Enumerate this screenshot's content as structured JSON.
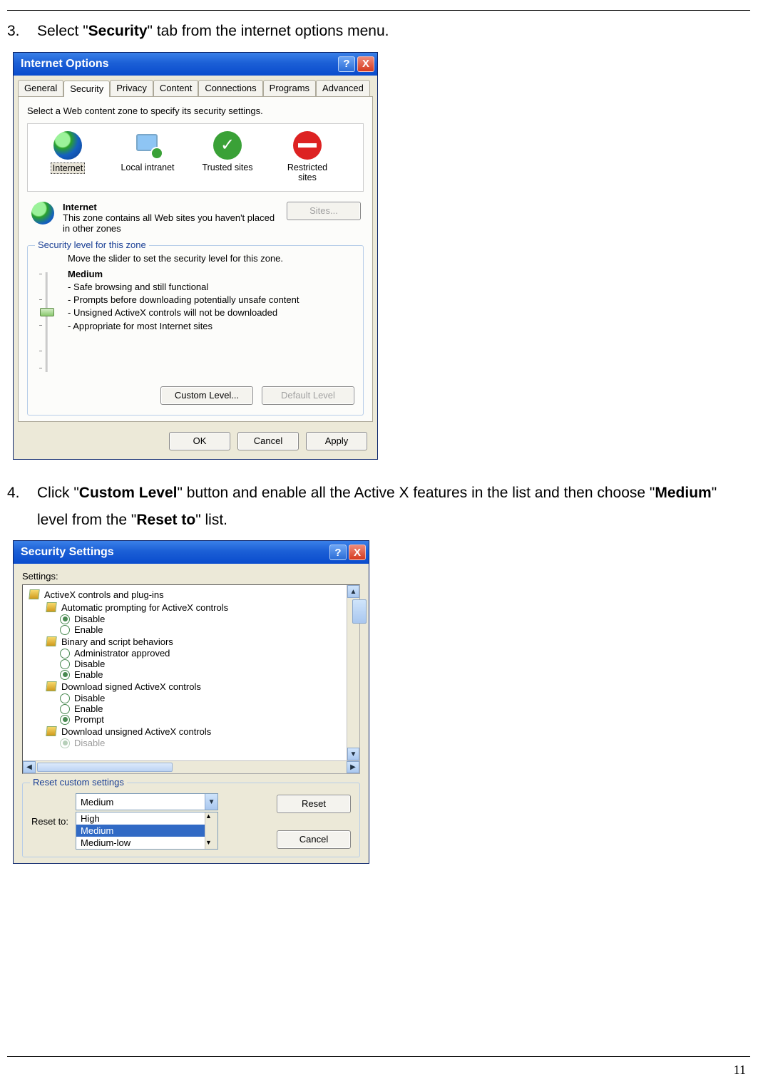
{
  "page_number": "11",
  "step3": {
    "num": "3.",
    "pre": "Select \"",
    "bold": "Security",
    "post": "\" tab from the internet options menu."
  },
  "step4": {
    "num": "4.",
    "pre1": "Click \"",
    "bold1": "Custom Level",
    "mid1": "\" button and enable all the Active X features in the list and then choose \"",
    "bold2": "Medium",
    "mid2": "\" level from the \"",
    "bold3": "Reset to",
    "post": "\" list."
  },
  "dialog1": {
    "title": "Internet Options",
    "help": "?",
    "close": "X",
    "tabs": [
      "General",
      "Security",
      "Privacy",
      "Content",
      "Connections",
      "Programs",
      "Advanced"
    ],
    "active_tab": "Security",
    "instr": "Select a Web content zone to specify its security settings.",
    "zones": {
      "internet": "Internet",
      "intranet": "Local intranet",
      "trusted": "Trusted sites",
      "restricted": "Restricted sites"
    },
    "zone_detail": {
      "heading": "Internet",
      "desc": "This zone contains all Web sites you haven't placed in other zones",
      "sites_btn": "Sites..."
    },
    "group_legend": "Security level for this zone",
    "slider_hint": "Move the slider to set the security level for this zone.",
    "level_name": "Medium",
    "bullets": [
      "- Safe browsing and still functional",
      "- Prompts before downloading potentially unsafe content",
      "- Unsigned ActiveX controls will not be downloaded",
      "- Appropriate for most Internet sites"
    ],
    "custom_btn": "Custom Level...",
    "default_btn": "Default Level",
    "ok": "OK",
    "cancel": "Cancel",
    "apply": "Apply"
  },
  "dialog2": {
    "title": "Security Settings",
    "help": "?",
    "close": "X",
    "settings_label": "Settings:",
    "tree": {
      "cat1": "ActiveX controls and plug-ins",
      "sub1": "Automatic prompting for ActiveX controls",
      "sub1_opts": [
        "Disable",
        "Enable"
      ],
      "sub1_sel": "Disable",
      "sub2": "Binary and script behaviors",
      "sub2_opts": [
        "Administrator approved",
        "Disable",
        "Enable"
      ],
      "sub2_sel": "Enable",
      "sub3": "Download signed ActiveX controls",
      "sub3_opts": [
        "Disable",
        "Enable",
        "Prompt"
      ],
      "sub3_sel": "Prompt",
      "sub4": "Download unsigned ActiveX controls",
      "sub4_partial": "Disable"
    },
    "reset_legend": "Reset custom settings",
    "reset_to_label": "Reset to:",
    "reset_value": "Medium",
    "reset_options": [
      "High",
      "Medium",
      "Medium-low"
    ],
    "reset_hover": "Medium",
    "reset_btn": "Reset",
    "cancel_btn": "Cancel"
  }
}
